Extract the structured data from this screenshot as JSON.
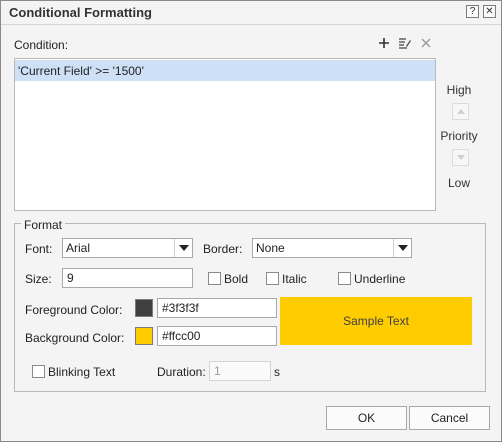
{
  "window": {
    "title": "Conditional Formatting",
    "help_glyph": "?",
    "close_glyph": "✕"
  },
  "condition": {
    "label": "Condition:",
    "toolbar_icons": [
      "add-icon",
      "edit-icon",
      "delete-icon"
    ],
    "items": [
      "'Current Field' >= '1500'"
    ],
    "selected_index": 0
  },
  "priority": {
    "high_label": "High",
    "label": "Priority",
    "low_label": "Low"
  },
  "format": {
    "legend": "Format",
    "font_label": "Font:",
    "font_value": "Arial",
    "border_label": "Border:",
    "border_value": "None",
    "size_label": "Size:",
    "size_value": "9",
    "bold_label": "Bold",
    "bold_checked": false,
    "italic_label": "Italic",
    "italic_checked": false,
    "underline_label": "Underline",
    "underline_checked": false,
    "fg_label": "Foreground Color:",
    "fg_value": "#3f3f3f",
    "bg_label": "Background Color:",
    "bg_value": "#ffcc00",
    "sample_text": "Sample Text",
    "blinking_label": "Blinking Text",
    "blinking_checked": false,
    "duration_label": "Duration:",
    "duration_value": "1",
    "duration_unit": "s"
  },
  "buttons": {
    "ok": "OK",
    "cancel": "Cancel"
  },
  "colors": {
    "selection": "#cde0f6",
    "foreground_swatch": "#3f3f3f",
    "background_swatch": "#ffcc00"
  }
}
